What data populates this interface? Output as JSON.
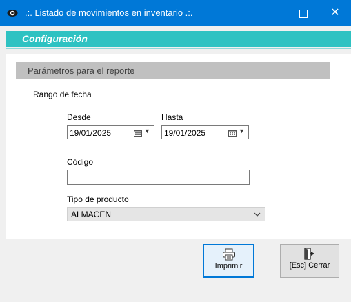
{
  "window": {
    "title": ".:. Listado de movimientos en inventario .:.",
    "icon": "eye-icon",
    "minimize_glyph": "—",
    "close_glyph": "✕"
  },
  "config_bar": {
    "title": "Configuración"
  },
  "params": {
    "header": "Parámetros para el reporte",
    "date_range_label": "Rango de fecha",
    "from_label": "Desde",
    "from_value": "19/01/2025",
    "to_label": "Hasta",
    "to_value": "19/01/2025",
    "code_label": "Código",
    "code_value": "",
    "product_type_label": "Tipo de producto",
    "product_type_value": "ALMACEN"
  },
  "buttons": {
    "print_label": "Imprimir",
    "close_label": "[Esc] Cerrar"
  },
  "colors": {
    "titlebar": "#0078d7",
    "accent": "#2ec2c2",
    "header_gray": "#c0c0c0"
  }
}
